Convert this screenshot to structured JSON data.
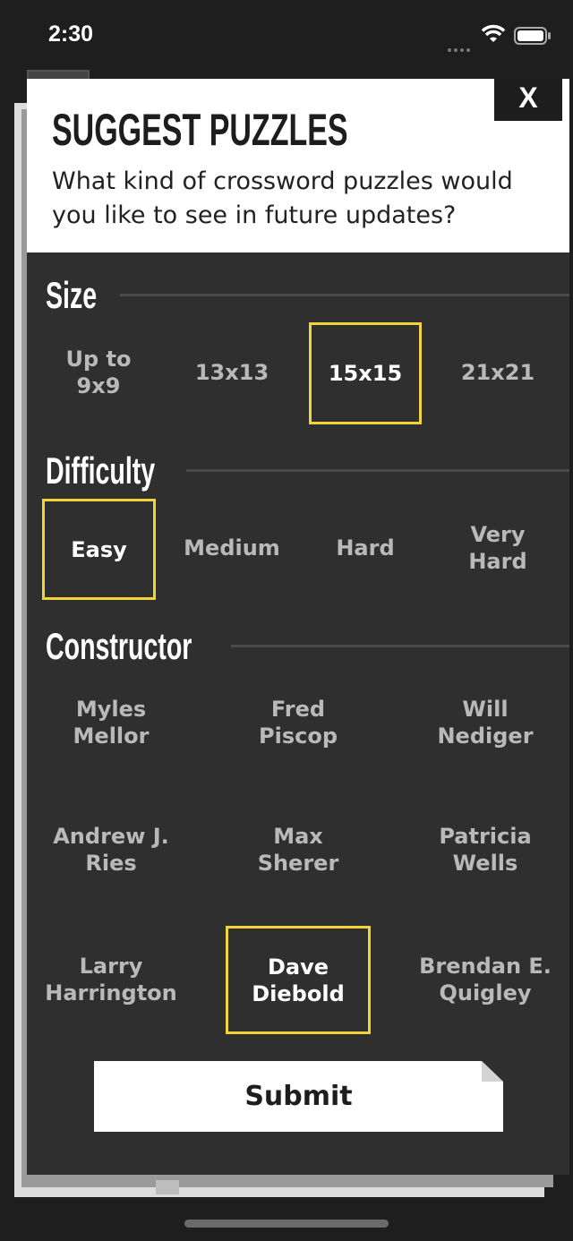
{
  "status_bar": {
    "time": "2:30"
  },
  "dialog": {
    "title": "SUGGEST PUZZLES",
    "subtitle": "What kind of crossword puzzles would you like to see in future updates?",
    "close_label": "X",
    "submit_label": "Submit"
  },
  "size": {
    "title": "Size",
    "options": [
      "Up to\n9x9",
      "13x13",
      "15x15",
      "21x21"
    ],
    "selected": "15x15"
  },
  "difficulty": {
    "title": "Difficulty",
    "options": [
      "Easy",
      "Medium",
      "Hard",
      "Very\nHard"
    ],
    "selected": "Easy"
  },
  "constructor": {
    "title": "Constructor",
    "options": [
      "Myles\nMellor",
      "Fred\nPiscop",
      "Will\nNediger",
      "Andrew J.\nRies",
      "Max\nSherer",
      "Patricia\nWells",
      "Larry\nHarrington",
      "Dave\nDiebold",
      "Brendan E.\nQuigley"
    ],
    "selected": "Dave\nDiebold"
  },
  "colors": {
    "selected_border": "#f0d43a",
    "sheet_background": "#2f2f2f",
    "header_background": "#ffffff"
  },
  "icons": [
    "wifi-icon",
    "battery-icon",
    "close-icon"
  ]
}
